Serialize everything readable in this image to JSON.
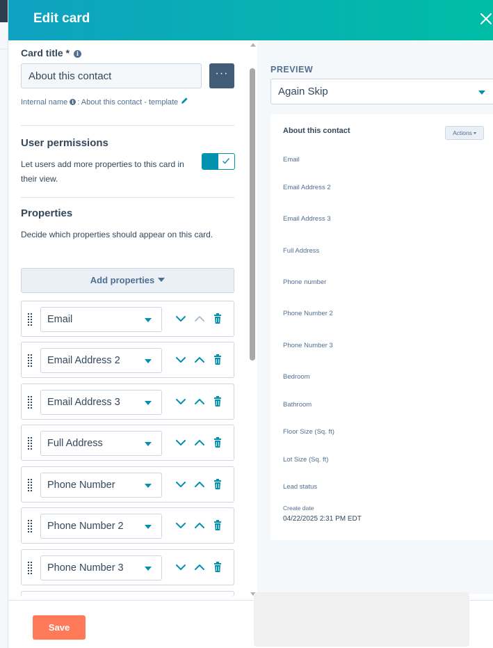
{
  "header": {
    "title": "Edit card"
  },
  "card_title": {
    "label": "Card title *",
    "value": "About this contact",
    "more_label": "···",
    "internal_label": "Internal name",
    "internal_value": ": About this contact - template"
  },
  "permissions": {
    "title": "User permissions",
    "description": "Let users add more properties to this card in their view.",
    "toggle_on": true
  },
  "properties": {
    "title": "Properties",
    "description": "Decide which properties should appear on this card.",
    "add_label": "Add properties",
    "rows": [
      {
        "label": "Email"
      },
      {
        "label": "Email Address 2"
      },
      {
        "label": "Email Address 3"
      },
      {
        "label": "Full Address"
      },
      {
        "label": "Phone Number"
      },
      {
        "label": "Phone Number 2"
      },
      {
        "label": "Phone Number 3"
      }
    ]
  },
  "preview": {
    "label": "PREVIEW",
    "selected": "Again Skip",
    "card_title": "About this contact",
    "actions_label": "Actions",
    "fields": [
      "Email",
      "Email Address 2",
      "Email Address 3",
      "Full Address",
      "Phone number",
      "Phone Number 2",
      "Phone Number 3",
      "Bedroom",
      "Bathroom",
      "Floor Size (Sq. ft)",
      "Lot Size (Sq. ft)",
      "Lead status"
    ],
    "create_date_label": "Create date",
    "create_date_value": "04/22/2025 2:31 PM EDT"
  },
  "footer": {
    "save_label": "Save"
  },
  "colors": {
    "accent": "#0091ae",
    "header_start": "#0fa2c1",
    "header_end": "#00bda5",
    "save": "#ff7a59",
    "dark_button": "#425b76"
  }
}
